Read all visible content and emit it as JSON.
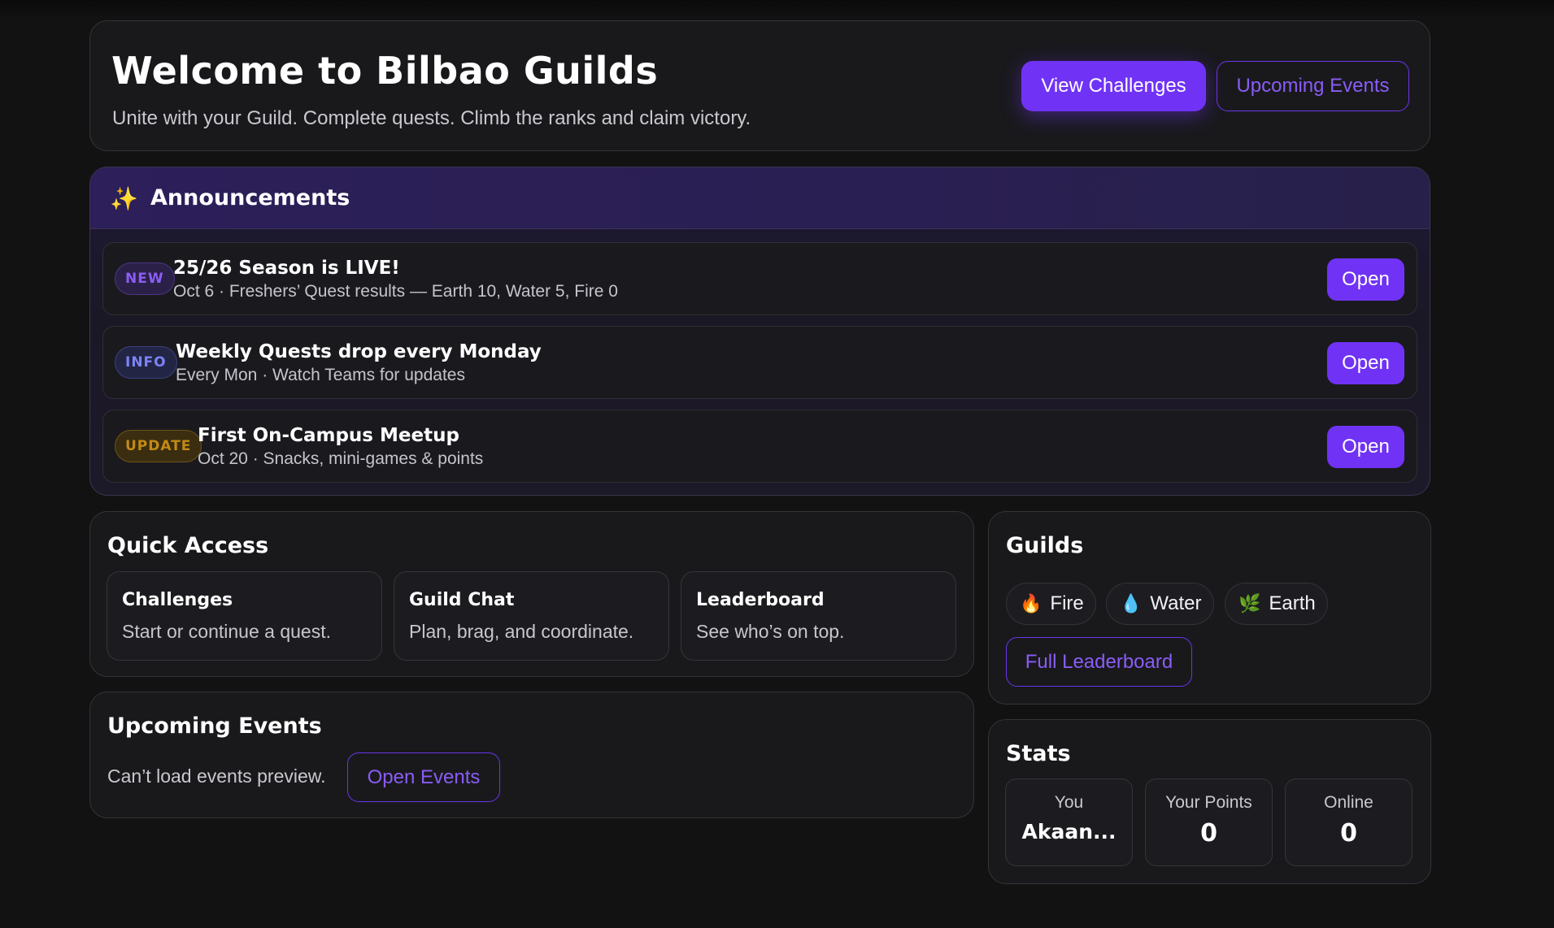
{
  "hero": {
    "title": "Welcome to Bilbao Guilds",
    "subtitle": "Unite with your Guild. Complete quests. Climb the ranks and claim victory.",
    "view_challenges_label": "View Challenges",
    "upcoming_events_label": "Upcoming Events"
  },
  "announcements": {
    "title": "Announcements",
    "icon": "sparkles-icon",
    "items": [
      {
        "badge": "NEW",
        "title": "25/26 Season is LIVE!",
        "subtitle": "Oct 6 · Freshers’ Quest results — Earth 10, Water 5, Fire 0",
        "action": "Open"
      },
      {
        "badge": "INFO",
        "title": "Weekly Quests drop every Monday",
        "subtitle": "Every Mon · Watch Teams for updates",
        "action": "Open"
      },
      {
        "badge": "UPDATE",
        "title": "First On-Campus Meetup",
        "subtitle": "Oct 20 · Snacks, mini-games & points",
        "action": "Open"
      }
    ]
  },
  "quick_access": {
    "title": "Quick Access",
    "tiles": [
      {
        "title": "Challenges",
        "subtitle": "Start or continue a quest."
      },
      {
        "title": "Guild Chat",
        "subtitle": "Plan, brag, and coordinate."
      },
      {
        "title": "Leaderboard",
        "subtitle": "See who’s on top."
      }
    ]
  },
  "upcoming_events": {
    "title": "Upcoming Events",
    "message": "Can’t load events preview.",
    "button_label": "Open Events"
  },
  "guilds": {
    "title": "Guilds",
    "chips": [
      {
        "icon": "fire-icon",
        "glyph": "🔥",
        "label": "Fire"
      },
      {
        "icon": "water-drop-icon",
        "glyph": "💧",
        "label": "Water"
      },
      {
        "icon": "herb-icon",
        "glyph": "🌿",
        "label": "Earth"
      }
    ],
    "leaderboard_label": "Full Leaderboard"
  },
  "stats": {
    "title": "Stats",
    "items": [
      {
        "label": "You",
        "value": "Akaan..."
      },
      {
        "label": "Your Points",
        "value": "0"
      },
      {
        "label": "Online",
        "value": "0"
      }
    ]
  },
  "colors": {
    "accent": "#7033f5",
    "background": "#121212",
    "card": "#19191c"
  }
}
